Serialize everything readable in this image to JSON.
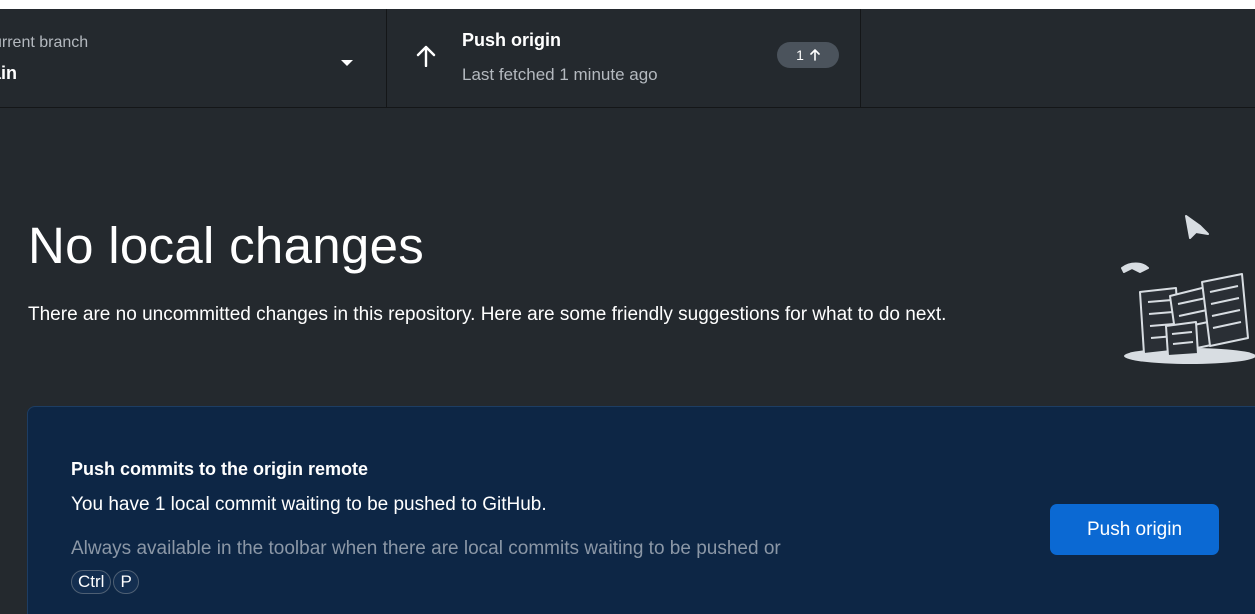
{
  "toolbar": {
    "branch": {
      "label": "urrent branch",
      "value": "ain"
    },
    "push": {
      "title": "Push origin",
      "subtitle": "Last fetched 1 minute ago",
      "badge_count": "1"
    }
  },
  "main": {
    "heading": "No local changes",
    "description": "There are no uncommitted changes in this repository. Here are some friendly suggestions for what to do next."
  },
  "suggestion": {
    "title": "Push commits to the origin remote",
    "line": "You have 1 local commit waiting to be pushed to GitHub.",
    "hint": "Always available in the toolbar when there are local commits waiting to be pushed or",
    "shortcut_keys": [
      "Ctrl",
      "P"
    ],
    "button_label": "Push origin"
  },
  "colors": {
    "background": "#24292e",
    "card_background": "#0d2645",
    "button": "#0b69d3",
    "badge": "#4b535c"
  }
}
